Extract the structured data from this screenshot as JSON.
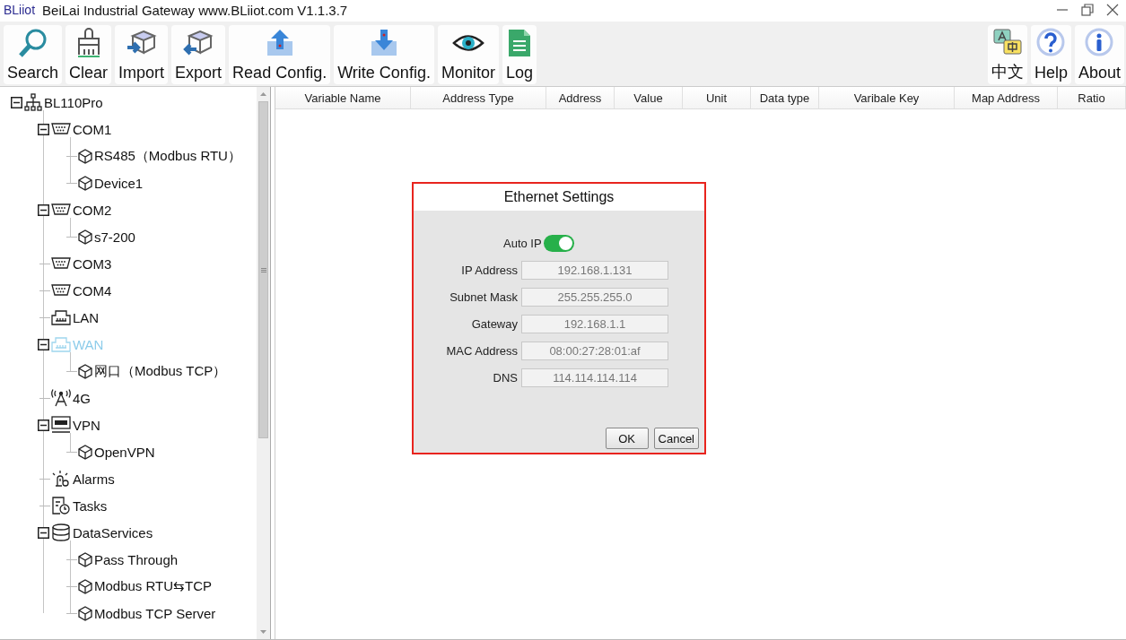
{
  "window": {
    "brand": "BLiiot",
    "title": "BeiLai Industrial Gateway www.BLiiot.com V1.1.3.7"
  },
  "toolbar": {
    "left": [
      {
        "label": "Search",
        "kind": "search"
      },
      {
        "label": "Clear",
        "kind": "clear"
      },
      {
        "label": "Import",
        "kind": "import"
      },
      {
        "label": "Export",
        "kind": "export"
      },
      {
        "label": "Read Config.",
        "kind": "read"
      },
      {
        "label": "Write Config.",
        "kind": "write"
      },
      {
        "label": "Monitor",
        "kind": "monitor"
      },
      {
        "label": "Log",
        "kind": "log"
      }
    ],
    "right": [
      {
        "label": "中文",
        "kind": "language"
      },
      {
        "label": "Help",
        "kind": "help"
      },
      {
        "label": "About",
        "kind": "about"
      }
    ]
  },
  "tree": [
    {
      "label": "BL110Pro",
      "kind": "gateway",
      "selected": false,
      "expanded": true,
      "children": [
        {
          "label": "COM1",
          "kind": "serial",
          "selected": false,
          "expanded": true,
          "children": [
            {
              "label": "RS485（Modbus RTU）",
              "kind": "device",
              "selected": false
            },
            {
              "label": "Device1",
              "kind": "device",
              "selected": false
            }
          ]
        },
        {
          "label": "COM2",
          "kind": "serial",
          "selected": false,
          "expanded": true,
          "children": [
            {
              "label": "s7-200",
              "kind": "device",
              "selected": false
            }
          ]
        },
        {
          "label": "COM3",
          "kind": "serial",
          "selected": false
        },
        {
          "label": "COM4",
          "kind": "serial",
          "selected": false
        },
        {
          "label": "LAN",
          "kind": "ethernet",
          "selected": false
        },
        {
          "label": "WAN",
          "kind": "ethernet",
          "selected": true,
          "expanded": true,
          "children": [
            {
              "label": "网口（Modbus TCP）",
              "kind": "device",
              "selected": false
            }
          ]
        },
        {
          "label": "4G",
          "kind": "antenna",
          "selected": false
        },
        {
          "label": "VPN",
          "kind": "vpn",
          "selected": false,
          "expanded": true,
          "children": [
            {
              "label": "OpenVPN",
              "kind": "device",
              "selected": false
            }
          ]
        },
        {
          "label": "Alarms",
          "kind": "alarm",
          "selected": false
        },
        {
          "label": "Tasks",
          "kind": "task",
          "selected": false
        },
        {
          "label": "DataServices",
          "kind": "database",
          "selected": false,
          "expanded": true,
          "children": [
            {
              "label": "Pass Through",
              "kind": "device",
              "selected": false
            },
            {
              "label": "Modbus RTU⇆TCP",
              "kind": "device",
              "selected": false
            },
            {
              "label": "Modbus TCP Server",
              "kind": "device",
              "selected": false
            }
          ]
        }
      ]
    }
  ],
  "table": {
    "columns": [
      "Variable Name",
      "Address Type",
      "Address",
      "Value",
      "Unit",
      "Data type",
      "Varibale Key",
      "Map Address",
      "Ratio"
    ]
  },
  "dialog": {
    "title": "Ethernet Settings",
    "auto_ip": {
      "label": "Auto IP",
      "on": true
    },
    "fields": [
      {
        "label": "IP Address",
        "value": "192.168.1.131"
      },
      {
        "label": "Subnet Mask",
        "value": "255.255.255.0"
      },
      {
        "label": "Gateway",
        "value": "192.168.1.1"
      },
      {
        "label": "MAC Address",
        "value": "08:00:27:28:01:af"
      },
      {
        "label": "DNS",
        "value": "114.114.114.114"
      }
    ],
    "buttons": [
      "OK",
      "Cancel"
    ]
  }
}
